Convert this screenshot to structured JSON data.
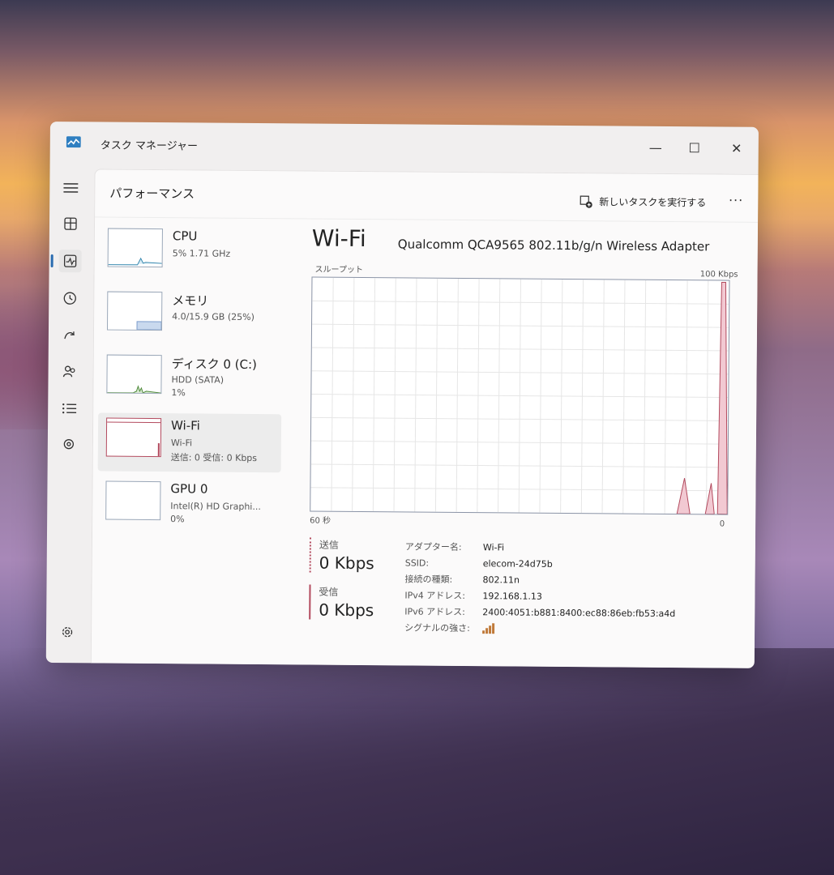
{
  "window": {
    "title": "タスク マネージャー",
    "minimize": "—",
    "maximize": "☐",
    "close": "✕"
  },
  "nav": [
    "hamburger-icon",
    "processes-icon",
    "performance-icon",
    "history-icon",
    "startup-icon",
    "users-icon",
    "details-icon",
    "services-icon",
    "settings-icon"
  ],
  "page": {
    "title": "パフォーマンス",
    "run_task": "新しいタスクを実行する",
    "more": "···"
  },
  "devices": [
    {
      "name": "CPU",
      "sub": "5%  1.71 GHz",
      "sub2": ""
    },
    {
      "name": "メモリ",
      "sub": "4.0/15.9 GB (25%)",
      "sub2": ""
    },
    {
      "name": "ディスク 0 (C:)",
      "sub": "HDD (SATA)",
      "sub2": "1%"
    },
    {
      "name": "Wi-Fi",
      "sub": "Wi-Fi",
      "sub2": "送信: 0 受信: 0 Kbps"
    },
    {
      "name": "GPU 0",
      "sub": "Intel(R) HD Graphi...",
      "sub2": "0%"
    }
  ],
  "graph": {
    "title": "Wi-Fi",
    "adapter": "Qualcomm QCA9565 802.11b/g/n Wireless Adapter",
    "label": "スループット",
    "max": "100 Kbps",
    "left": "60 秒",
    "right": "0"
  },
  "stats": {
    "send_label": "送信",
    "send_value": "0 Kbps",
    "recv_label": "受信",
    "recv_value": "0 Kbps"
  },
  "properties": [
    {
      "k": "アダプター名:",
      "v": "Wi-Fi"
    },
    {
      "k": "SSID:",
      "v": "elecom-24d75b"
    },
    {
      "k": "接続の種類:",
      "v": "802.11n"
    },
    {
      "k": "IPv4 アドレス:",
      "v": "192.168.1.13"
    },
    {
      "k": "IPv6 アドレス:",
      "v": "2400:4051:b881:8400:ec88:86eb:fb53:a4d"
    },
    {
      "k": "シグナルの強さ:",
      "v": ""
    }
  ],
  "colors": {
    "accent": "#2b6cb0",
    "wifi": "#b34a5e",
    "wifi_fill": "#f2c9d2",
    "cpu": "#3a8ab0",
    "disk": "#4f8a3a",
    "memory": "#7b9ccc"
  }
}
